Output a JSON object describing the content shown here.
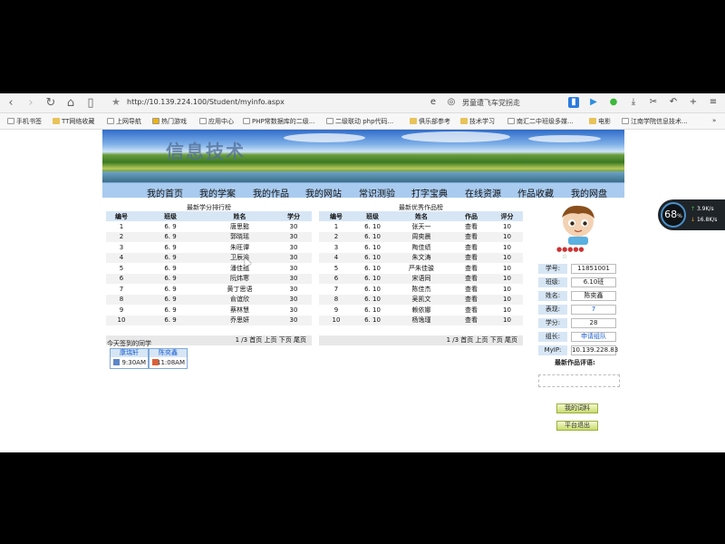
{
  "browser": {
    "url": "http://10.139.224.100/Student/myinfo.aspx",
    "search_text": "男童遭飞车党拐走"
  },
  "bookmarks": [
    {
      "label": "手机书签",
      "type": "page"
    },
    {
      "label": "TT网络收藏",
      "type": "folder"
    },
    {
      "label": "上网导航",
      "type": "page"
    },
    {
      "label": "热门游戏",
      "type": "star"
    },
    {
      "label": "应用中心",
      "type": "page"
    },
    {
      "label": "PHP常数据库的二级...",
      "type": "page"
    },
    {
      "label": "二级联动 php代码...",
      "type": "page"
    },
    {
      "label": "俱乐部参考",
      "type": "folder"
    },
    {
      "label": "技术学习",
      "type": "folder"
    },
    {
      "label": "南汇二中班级多媒...",
      "type": "page"
    },
    {
      "label": "电影",
      "type": "folder"
    },
    {
      "label": "江南学院信息技术...",
      "type": "page"
    }
  ],
  "banner": {
    "title": "信息技术"
  },
  "nav": [
    "我的首页",
    "我的学案",
    "我的作品",
    "我的网站",
    "常识测验",
    "打字宝典",
    "在线资源",
    "作品收藏",
    "我的网盘"
  ],
  "score_table": {
    "title": "最新学分排行榜",
    "headers": [
      "编号",
      "班级",
      "姓名",
      "学分"
    ],
    "rows": [
      [
        "1",
        "6. 9",
        "唐思懿",
        "30"
      ],
      [
        "2",
        "6. 9",
        "郭晓瑶",
        "30"
      ],
      [
        "3",
        "6. 9",
        "朱旺谭",
        "30"
      ],
      [
        "4",
        "6. 9",
        "卫辰渝",
        "30"
      ],
      [
        "5",
        "6. 9",
        "潘佳蕴",
        "30"
      ],
      [
        "6",
        "6. 9",
        "阮炜寒",
        "30"
      ],
      [
        "7",
        "6. 9",
        "黄丁思语",
        "30"
      ],
      [
        "8",
        "6. 9",
        "俞谊欣",
        "30"
      ],
      [
        "9",
        "6. 9",
        "蔡林慧",
        "30"
      ],
      [
        "10",
        "6. 9",
        "乔思妍",
        "30"
      ]
    ],
    "pager": "1 /3  首页 上页 下页 尾页"
  },
  "works_table": {
    "title": "最新优秀作品榜",
    "headers": [
      "编号",
      "班级",
      "姓名",
      "作品",
      "评分"
    ],
    "rows": [
      [
        "1",
        "6. 10",
        "张天一",
        "查看",
        "10"
      ],
      [
        "2",
        "6. 10",
        "周奕晨",
        "查看",
        "10"
      ],
      [
        "3",
        "6. 10",
        "陶佳绩",
        "查看",
        "10"
      ],
      [
        "4",
        "6. 10",
        "朱文涛",
        "查看",
        "10"
      ],
      [
        "5",
        "6. 10",
        "严朱佳骏",
        "查看",
        "10"
      ],
      [
        "6",
        "6. 10",
        "宋语同",
        "查看",
        "10"
      ],
      [
        "7",
        "6. 10",
        "陈佳杰",
        "查看",
        "10"
      ],
      [
        "8",
        "6. 10",
        "吴凯文",
        "查看",
        "10"
      ],
      [
        "9",
        "6. 10",
        "赖依娜",
        "查看",
        "10"
      ],
      [
        "10",
        "6. 10",
        "杨逸瑾",
        "查看",
        "10"
      ]
    ],
    "pager": "1 /3  首页 上页 下页 尾页"
  },
  "signin": {
    "title": "今天签到的同学",
    "students": [
      {
        "name": "康瑞轩",
        "time": "9:30AM"
      },
      {
        "name": "陈奕鑫",
        "time": "11:08AM"
      }
    ]
  },
  "profile": {
    "fields": [
      {
        "label": "学号:",
        "value": "11851001",
        "link": false
      },
      {
        "label": "班级:",
        "value": "6.10班",
        "link": false
      },
      {
        "label": "姓名:",
        "value": "陈奕鑫",
        "link": false
      },
      {
        "label": "表现:",
        "value": "7",
        "link": true
      },
      {
        "label": "学分:",
        "value": "28",
        "link": false
      },
      {
        "label": "组长:",
        "value": "申请组队",
        "link": true
      },
      {
        "label": "MyIP:",
        "value": "10.139.228.83",
        "link": false
      }
    ],
    "comment_title": "最新作品评语:",
    "buttons": [
      "我的词料",
      "平台退出"
    ]
  },
  "net_widget": {
    "percent": "68",
    "unit": "%",
    "up": "3.9",
    "down": "16.8",
    "rate_unit": "K/s"
  }
}
